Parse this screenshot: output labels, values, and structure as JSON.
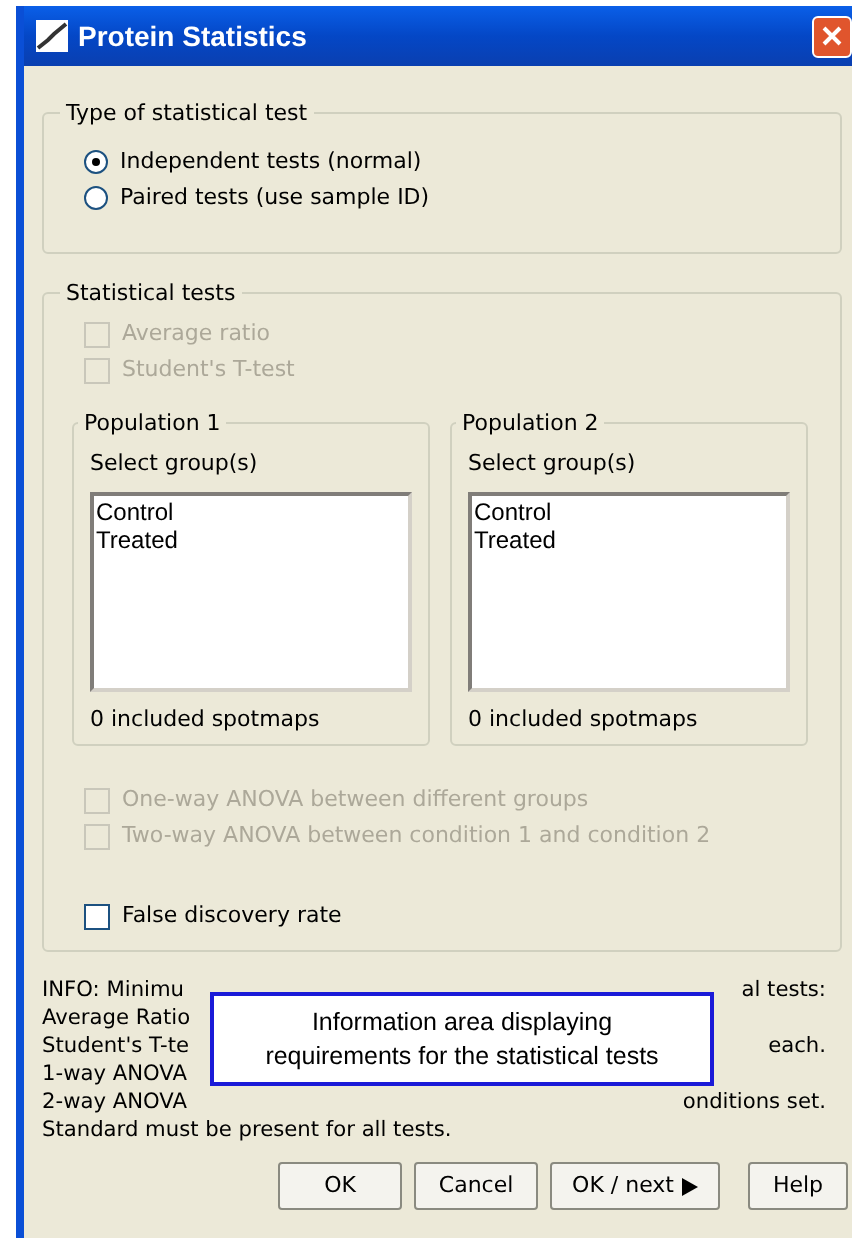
{
  "window": {
    "title": "Protein Statistics"
  },
  "test_type": {
    "legend": "Type of statistical test",
    "options": [
      {
        "label": "Independent tests (normal)",
        "selected": true
      },
      {
        "label": "Paired tests (use sample ID)",
        "selected": false
      }
    ]
  },
  "statistical_tests": {
    "legend": "Statistical tests",
    "tests_top": [
      {
        "label": "Average ratio",
        "checked": false,
        "disabled": true
      },
      {
        "label": "Student's T-test",
        "checked": false,
        "disabled": true
      }
    ],
    "populations": [
      {
        "legend": "Population 1",
        "prompt": "Select group(s)",
        "groups": [
          {
            "label": "Control",
            "selected": false
          },
          {
            "label": "Treated",
            "selected": false
          }
        ],
        "count": "0 included spotmaps"
      },
      {
        "legend": "Population 2",
        "prompt": "Select group(s)",
        "groups": [
          {
            "label": "Control",
            "selected": false
          },
          {
            "label": "Treated",
            "selected": false
          }
        ],
        "count": "0 included spotmaps"
      }
    ],
    "tests_bottom": [
      {
        "label": "One-way ANOVA between different groups",
        "checked": false,
        "disabled": true
      },
      {
        "label": "Two-way ANOVA between condition 1 and condition 2",
        "checked": false,
        "disabled": true
      }
    ],
    "fdr": {
      "label": "False discovery rate",
      "checked": false,
      "disabled": false
    }
  },
  "info": {
    "lines": [
      {
        "left": "INFO: Minimu",
        "right": "al tests:"
      },
      {
        "left": "Average Ratio"
      },
      {
        "left": "Student's T-te",
        "right": "each."
      },
      {
        "left": "1-way ANOVA"
      },
      {
        "left": "2-way ANOVA",
        "right": "onditions set."
      },
      {
        "left": "Standard must be present for all tests."
      }
    ]
  },
  "callout": {
    "text": "Information area displaying requirements for the statistical tests"
  },
  "buttons": [
    {
      "label": "OK",
      "arrow": false
    },
    {
      "label": "Cancel",
      "arrow": false
    },
    {
      "label": "OK / next",
      "arrow": true
    },
    {
      "label": "Help",
      "arrow": false
    }
  ]
}
